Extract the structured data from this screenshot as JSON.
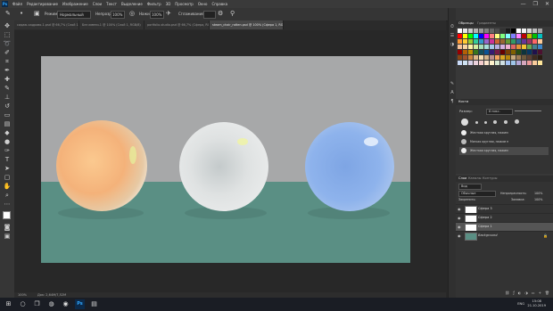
{
  "menubar": {
    "logo": "Ps",
    "items": [
      "Файл",
      "Редактирование",
      "Изображение",
      "Слои",
      "Текст",
      "Выделение",
      "Фильтр",
      "3D",
      "Просмотр",
      "Окно",
      "Справка"
    ],
    "window_controls": [
      "—",
      "❐",
      "✕"
    ]
  },
  "options": {
    "mode_label": "Режим:",
    "mode_value": "Нормальный",
    "opacity_label": "Непрозр.:",
    "opacity_value": "100%",
    "press_label": "Нажим:",
    "press_value": "100%",
    "smoothing_label": "Сглаживание:"
  },
  "tabs": [
    {
      "label": "сидаю-кадрово-1.psd @ 66,7% (Слой 1, RGB/8#)",
      "active": false
    },
    {
      "label": "Без имени-1 @ 100% (Слой 1, RGB/8)",
      "active": false
    },
    {
      "label": "portfolio-studio.psd @ 66,7% (Сфера, RGB/8)",
      "active": false
    },
    {
      "label": "steam_chair_rotten.psd @ 100% (Сфера 1, RGB/8*)",
      "active": true
    }
  ],
  "status": {
    "zoom": "100%",
    "doc": "Док: 2,64M/7,52M"
  },
  "panels": {
    "swatches_tabs": [
      "Образцы",
      "Градиенты"
    ],
    "brush_tab": "Кисти",
    "brush_size_label": "Размер:",
    "brush_size_value": "8 пикс.",
    "brush_names": [
      "Жесткая круглая, нажим",
      "Мягкая круглая, нажим н",
      "Жесткая круглая, нажим"
    ],
    "layers_tabs": [
      "Слои",
      "Каналы",
      "Контуры"
    ],
    "kind_label": "Вид",
    "blend_value": "Обычные",
    "opacity_label": "Непрозрачность:",
    "opacity_value": "100%",
    "lock_label": "Закрепить:",
    "fill_label": "Заливка:",
    "fill_value": "100%",
    "layers": [
      {
        "name": "Сфера 3",
        "selected": false
      },
      {
        "name": "Сфера 2",
        "selected": false
      },
      {
        "name": "Сфера 1",
        "selected": true
      },
      {
        "name": "Background",
        "selected": false
      }
    ]
  },
  "taskbar": {
    "lang": "ENG",
    "time": "15:08",
    "date": "21.10.2019"
  },
  "colors": {
    "wall": "#a7a8a9",
    "floor": "#5a8f84",
    "sphere_orange": "#f7b97a",
    "sphere_white": "#dde0e1",
    "sphere_blue": "#8fb2e8"
  }
}
